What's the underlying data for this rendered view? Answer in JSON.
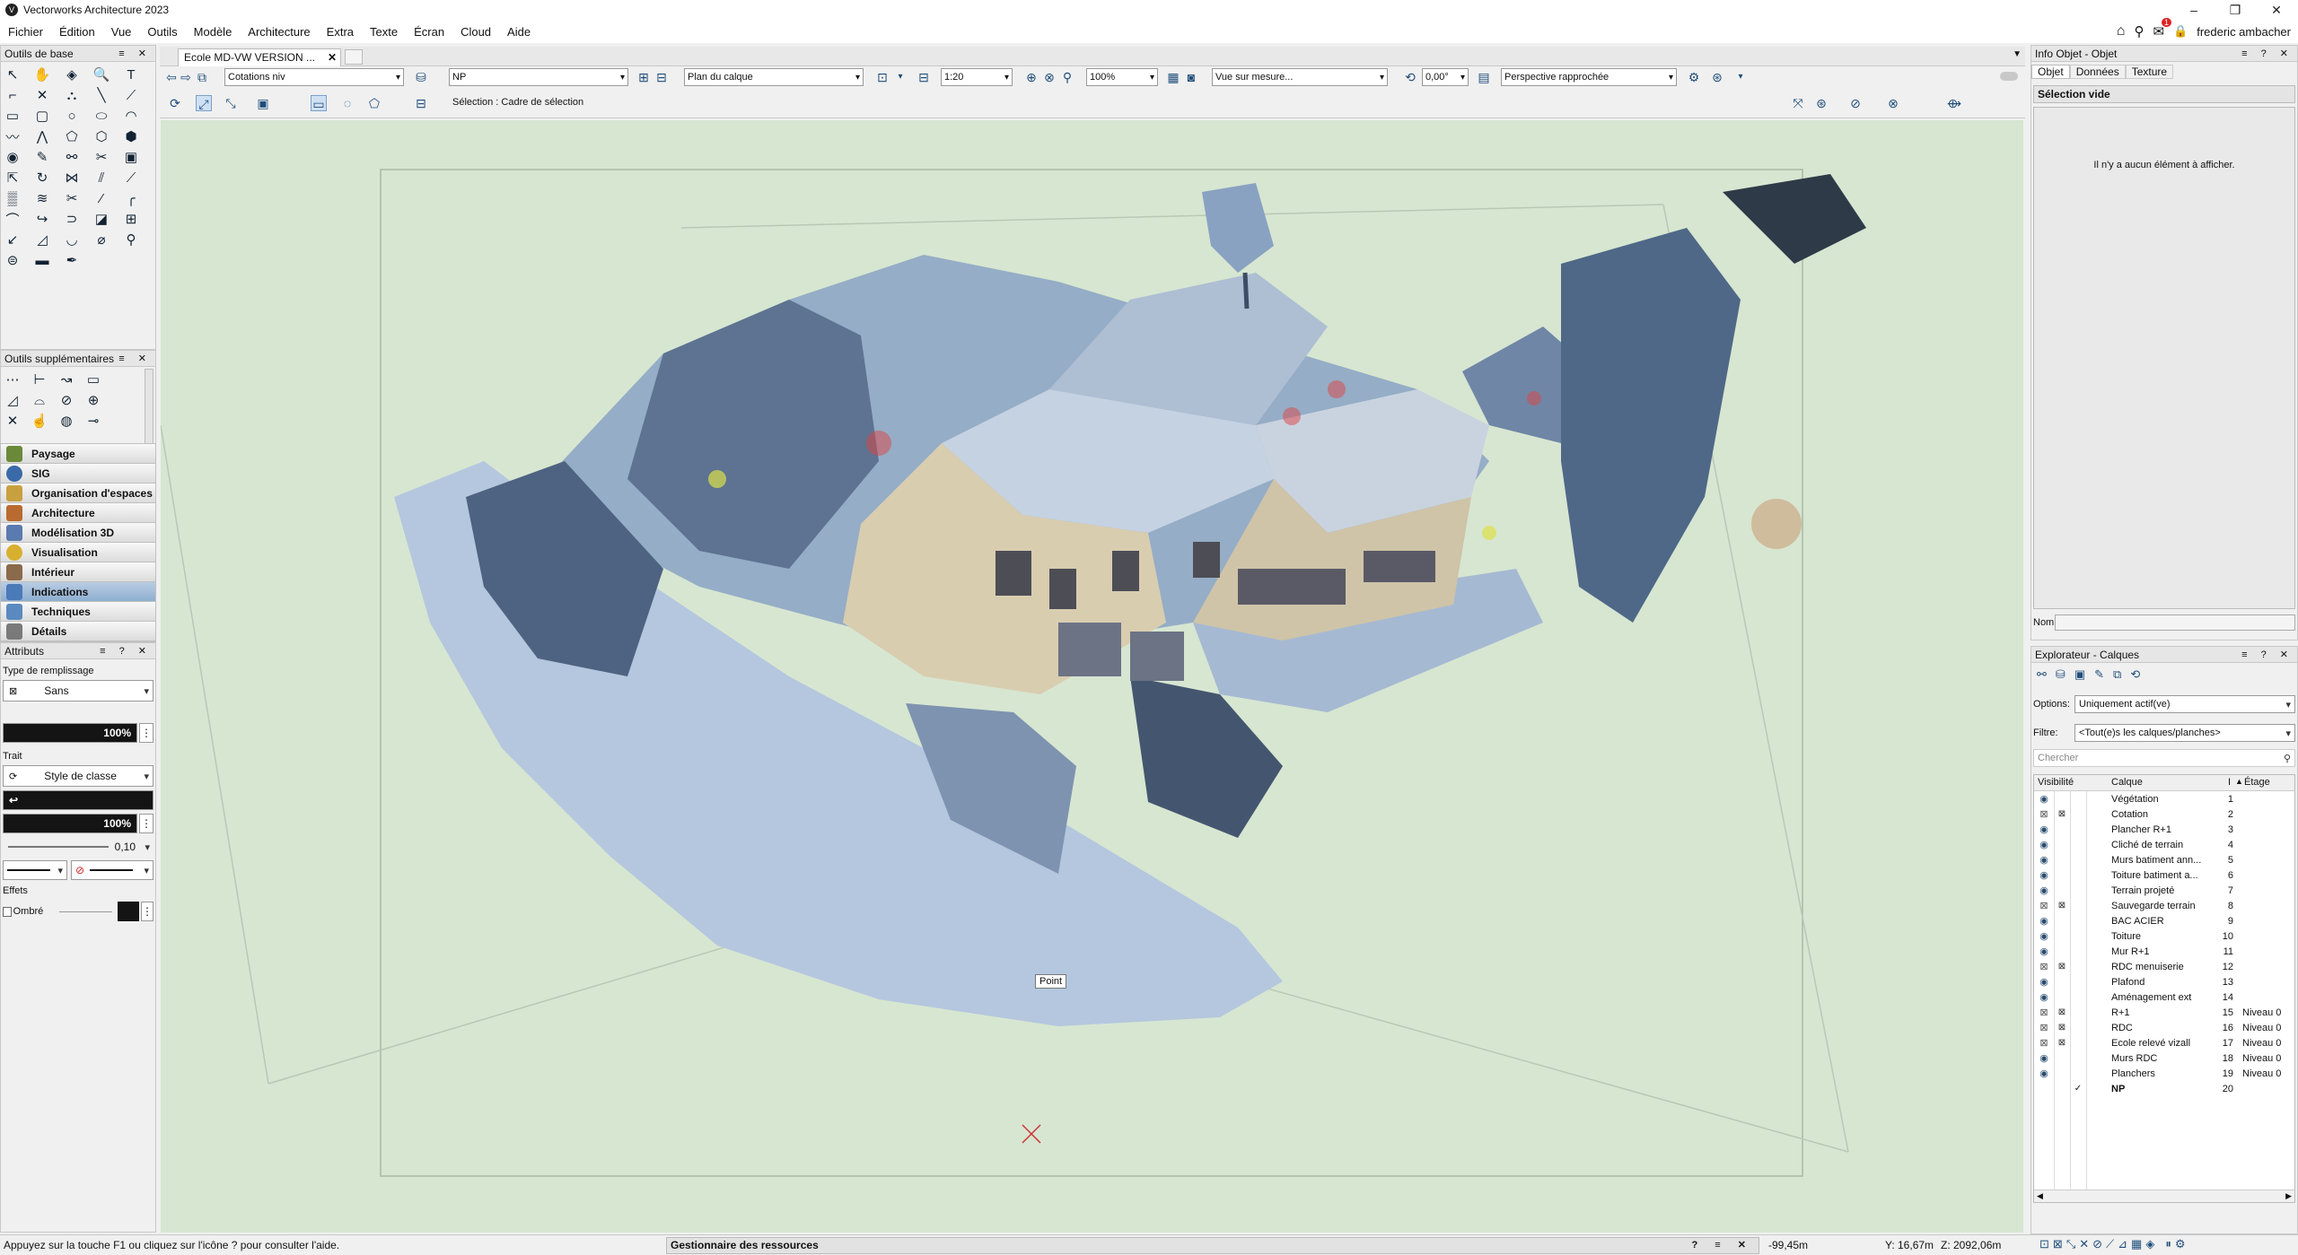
{
  "app": {
    "title": "Vectorworks Architecture 2023",
    "user": "frederic ambacher",
    "notif_count": "1"
  },
  "menu": [
    "Fichier",
    "Édition",
    "Vue",
    "Outils",
    "Modèle",
    "Architecture",
    "Extra",
    "Texte",
    "Écran",
    "Cloud",
    "Aide"
  ],
  "doc": {
    "tab": "Ecole MD-VW VERSION ..."
  },
  "viewbar": {
    "class": "Cotations niv",
    "layer": "NP",
    "layer_plane": "Plan du calque",
    "scale": "1:20",
    "zoom": "100%",
    "view": "Vue sur mesure...",
    "angle": "0,00°",
    "projection": "Perspective rapprochée"
  },
  "modebar": {
    "selection_label": "Sélection : Cadre de sélection"
  },
  "basic_tools": {
    "title": "Outils de base"
  },
  "extra_tools": {
    "title": "Outils supplémentaires"
  },
  "palettes": [
    {
      "label": "Paysage",
      "color": "#6a8a3a",
      "selected": false
    },
    {
      "label": "SIG",
      "color": "#3a6aa8",
      "selected": false
    },
    {
      "label": "Organisation d'espaces",
      "color": "#c8a040",
      "selected": false
    },
    {
      "label": "Architecture",
      "color": "#b86a30",
      "selected": false
    },
    {
      "label": "Modélisation 3D",
      "color": "#5a7ab0",
      "selected": false
    },
    {
      "label": "Visualisation",
      "color": "#d8b030",
      "selected": false
    },
    {
      "label": "Intérieur",
      "color": "#8a6a4a",
      "selected": false
    },
    {
      "label": "Indications",
      "color": "#4a7ab8",
      "selected": true
    },
    {
      "label": "Techniques",
      "color": "#5a8ac0",
      "selected": false
    },
    {
      "label": "Détails",
      "color": "#7a7a7a",
      "selected": false
    }
  ],
  "attributes": {
    "title": "Attributs",
    "fill_type_label": "Type de remplissage",
    "fill_value": "Sans",
    "fill_opacity": "100%",
    "stroke_label": "Trait",
    "stroke_style": "Style de classe",
    "stroke_opacity": "100%",
    "line_weight": "0,10",
    "effects_label": "Effets",
    "shadow_label": "Ombré"
  },
  "info": {
    "title": "Info Objet - Objet",
    "tabs": [
      "Objet",
      "Données",
      "Texture"
    ],
    "selection": "Sélection vide",
    "empty_msg": "Il n'y a aucun élément à afficher.",
    "name_label": "Nom:"
  },
  "explorer": {
    "title": "Explorateur - Calques",
    "options_label": "Options:",
    "options_value": "Uniquement actif(ve)",
    "filter_label": "Filtre:",
    "filter_value": "<Tout(e)s les calques/planches>",
    "search_placeholder": "Chercher",
    "col_visibility": "Visibilité",
    "col_layer": "Calque",
    "col_num": "I",
    "col_floor": "Étage"
  },
  "layers": [
    {
      "name": "Végétation",
      "num": "1",
      "level": "",
      "vis": "eye"
    },
    {
      "name": "Cotation",
      "num": "2",
      "level": "",
      "vis": "gray"
    },
    {
      "name": "Plancher R+1",
      "num": "3",
      "level": "",
      "vis": "eye"
    },
    {
      "name": "Cliché de terrain",
      "num": "4",
      "level": "",
      "vis": "eye"
    },
    {
      "name": "Murs batiment ann...",
      "num": "5",
      "level": "",
      "vis": "eye"
    },
    {
      "name": "Toiture batiment a...",
      "num": "6",
      "level": "",
      "vis": "eye"
    },
    {
      "name": "Terrain projeté",
      "num": "7",
      "level": "",
      "vis": "eye"
    },
    {
      "name": "Sauvegarde terrain",
      "num": "8",
      "level": "",
      "vis": "gray"
    },
    {
      "name": "BAC ACIER",
      "num": "9",
      "level": "",
      "vis": "eye"
    },
    {
      "name": "Toiture",
      "num": "10",
      "level": "",
      "vis": "eye"
    },
    {
      "name": "Mur R+1",
      "num": "11",
      "level": "",
      "vis": "eye"
    },
    {
      "name": "RDC menuiserie",
      "num": "12",
      "level": "",
      "vis": "gray"
    },
    {
      "name": "Plafond",
      "num": "13",
      "level": "",
      "vis": "eye"
    },
    {
      "name": "Aménagement ext",
      "num": "14",
      "level": "",
      "vis": "eye"
    },
    {
      "name": "R+1",
      "num": "15",
      "level": "Niveau 0",
      "vis": "gray"
    },
    {
      "name": "RDC",
      "num": "16",
      "level": "Niveau 0",
      "vis": "gray"
    },
    {
      "name": "Ecole relevé vizall",
      "num": "17",
      "level": "Niveau 0",
      "vis": "gray"
    },
    {
      "name": "Murs RDC",
      "num": "18",
      "level": "Niveau 0",
      "vis": "eye"
    },
    {
      "name": "Planchers",
      "num": "19",
      "level": "Niveau 0",
      "vis": "eye"
    },
    {
      "name": "NP",
      "num": "20",
      "level": "",
      "vis": "active"
    }
  ],
  "viewport": {
    "tooltip": "Point"
  },
  "status": {
    "help": "Appuyez sur la touche F1 ou cliquez sur l'icône ? pour consulter l'aide.",
    "resource_manager": "Gestionnaire des ressources",
    "x": "-99,45m",
    "y": "Y: 16,67m",
    "z": "Z: 2092,06m"
  }
}
